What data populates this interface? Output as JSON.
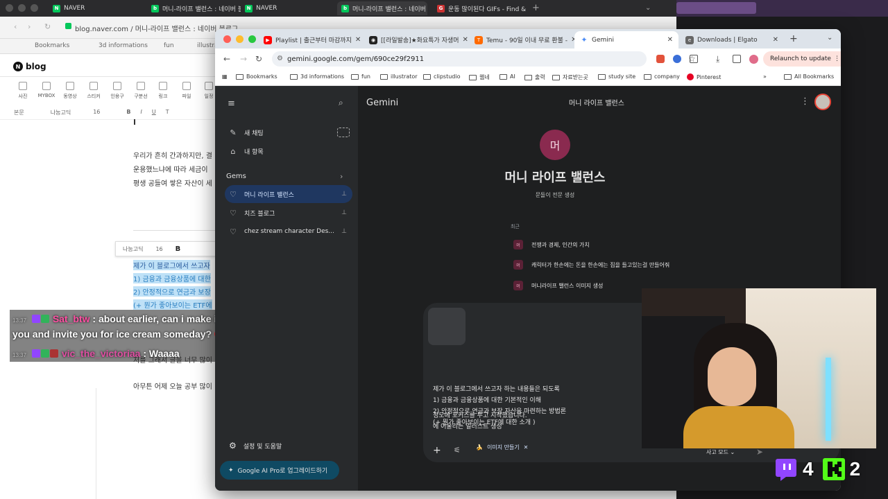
{
  "bg_window": {
    "tabs": [
      {
        "label": "NAVER"
      },
      {
        "label": "머니-라이프 밸런스 : 네이버 블로"
      },
      {
        "label": "NAVER"
      },
      {
        "label": "머니-라이프 밸런스 : 네이버 블로"
      },
      {
        "label": "운동 많이된다 GIFs - Find & Sh"
      }
    ],
    "url": "blog.naver.com / 머니-라이프 밸런스 : 네이버 블로그",
    "bookmarks": [
      "Bookmarks",
      "3d informations",
      "fun",
      "illustra"
    ],
    "blog_logo": "blog",
    "tools": [
      "사진",
      "MYBOX",
      "동영상",
      "스티커",
      "인용구",
      "구분선",
      "링크",
      "파일",
      "일정"
    ],
    "format_row": [
      "본문",
      "나눔고딕",
      "16",
      "B",
      "I",
      "U",
      "T"
    ],
    "paragraph1": [
      "우리가 흔히 간과하지만, 결",
      "운용했느냐에 따라 세금이",
      "평생 공들여 쌓은 자산이 세"
    ],
    "mini_format": [
      "나눔고딕",
      "16",
      "B"
    ],
    "selected_lines": [
      "제가 이 블로그에서 쓰고자",
      "1) 금융과 금융상품에 대한",
      "2) 안정적으로 연금과 보장",
      "(+ 뭔가 좋아보이는 ETF에"
    ],
    "line_after": "저를 그래서 글을 너무 많이",
    "line_last": "아무튼 어제 오늘 공부 많이"
  },
  "chat": {
    "messages": [
      {
        "time": "13:37",
        "user": "Sat_btw",
        "text": ": about earlier, can i make it up to",
        "text2": "you and invite you for ice cream someday?"
      },
      {
        "time": "13:37",
        "user": "vic_the_victoriaa",
        "text": ": Waaaa"
      }
    ]
  },
  "chrome": {
    "tabs": [
      {
        "label": "Playlist | 출근부터 마감까지",
        "color": "#ff0000"
      },
      {
        "label": "[[라일발송]★화요특가 자생머",
        "color": "#222222"
      },
      {
        "label": "Temu - 90일 이내 무료 환불 -",
        "color": "#ff6a00"
      },
      {
        "label": "Gemini",
        "color": "#4b8bf5"
      },
      {
        "label": "Downloads | Elgato",
        "color": "#666666"
      }
    ],
    "url": "gemini.google.com/gem/690ce29f2911",
    "relaunch": "Relaunch to update",
    "bookmarks": [
      "Bookmarks",
      "3d informations",
      "fun",
      "illustrator",
      "clipstudio",
      "웹네",
      "AI",
      "출력",
      "자료받는곳",
      "study site",
      "company",
      "Pinterest",
      "All Bookmarks"
    ]
  },
  "gemini": {
    "app_title": "Gemini",
    "header_title": "머니 라이프 밸런스",
    "sidebar": {
      "new_chat": "새 채팅",
      "my_stuff": "내 항목",
      "gems_header": "Gems",
      "gems": [
        {
          "label": "머니 라이프 밸런스",
          "selected": true
        },
        {
          "label": "치즈 블로그",
          "selected": false
        },
        {
          "label": "chez stream character Des...",
          "selected": false
        }
      ],
      "settings": "설정 및 도움말",
      "upgrade": "Google AI Pro로 업그레이드하기"
    },
    "avatar_letter": "머",
    "gem_name": "머니 라이프 밸런스",
    "gem_desc": "문돌이 전문 생성",
    "recent_label": "최근",
    "recent": [
      {
        "badge": "머",
        "text": "전쟁과 경제, 인간의 가치"
      },
      {
        "badge": "머",
        "text": "캐릭터가 한손에는 돈을 한손에는 집을 들고있는걸 만들어줘"
      },
      {
        "badge": "머",
        "text": "머니라이프 밸런스 이미지 생성"
      }
    ],
    "prompt_lines": [
      "제가 이 블로그에서 쓰고자 하는 내용들은 되도록",
      "1) 금융과 금융상품에 대한 기본적인 이해",
      "2) 안정적으로 연금과 보장 자산을 마련하는 방법론",
      "(+ 뭔가 좋아보이는 ETF에 대한 소개 )",
      "",
      "정도에 포커스를 두고 시작했습니다.",
      "에 어울리는 일러스트 생성"
    ],
    "image_chip": "이미지 만들기",
    "thinking_mode": "사고 모드"
  },
  "overlay": {
    "count1": "4",
    "count2": "2",
    "color1": "#9146ff",
    "color2": "#53fc18"
  }
}
